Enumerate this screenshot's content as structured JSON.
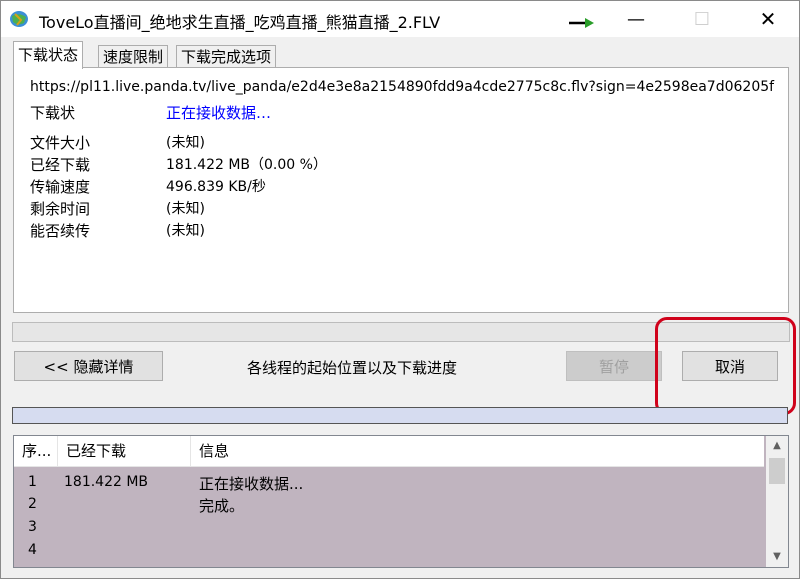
{
  "window": {
    "title": "ToveLo直播间_绝地求生直播_吃鸡直播_熊猫直播_2.FLV",
    "minimize": "—",
    "maximize": "☐",
    "close": "✕"
  },
  "tabs": [
    {
      "label": "下载状态",
      "active": true
    },
    {
      "label": "速度限制",
      "active": false
    },
    {
      "label": "下载完成选项",
      "active": false
    }
  ],
  "status": {
    "url": "https://pl11.live.panda.tv/live_panda/e2d4e3e8a2154890fdd9a4cde2775c8c.flv?sign=4e2598ea7d06205f",
    "rows": [
      {
        "label": "下载状",
        "value": "正在接收数据…"
      },
      {
        "label": "文件大小",
        "value": "(未知)"
      },
      {
        "label": "已经下载",
        "value": "181.422 MB（0.00 %）"
      },
      {
        "label": "传输速度",
        "value": "496.839 KB/秒"
      },
      {
        "label": "剩余时间",
        "value": "(未知)"
      },
      {
        "label": "能否续传",
        "value": "(未知)"
      }
    ]
  },
  "progress": {
    "percent": 0.0
  },
  "buttons": {
    "hide_details": "<< 隐藏详情",
    "pause": "暂停",
    "cancel": "取消"
  },
  "threads_label": "各线程的起始位置以及下载进度",
  "list": {
    "headers": [
      "序...",
      "已经下载",
      "信息"
    ],
    "rows": [
      {
        "index": "1",
        "downloaded": "181.422 MB",
        "info": "正在接收数据..."
      },
      {
        "index": "2",
        "downloaded": "",
        "info": "完成。"
      },
      {
        "index": "3",
        "downloaded": "",
        "info": ""
      },
      {
        "index": "4",
        "downloaded": "",
        "info": ""
      }
    ]
  },
  "colors": {
    "accent_blue": "#0000ff",
    "highlight_red": "#d0021b",
    "list_bg": "#c0b4bf"
  }
}
